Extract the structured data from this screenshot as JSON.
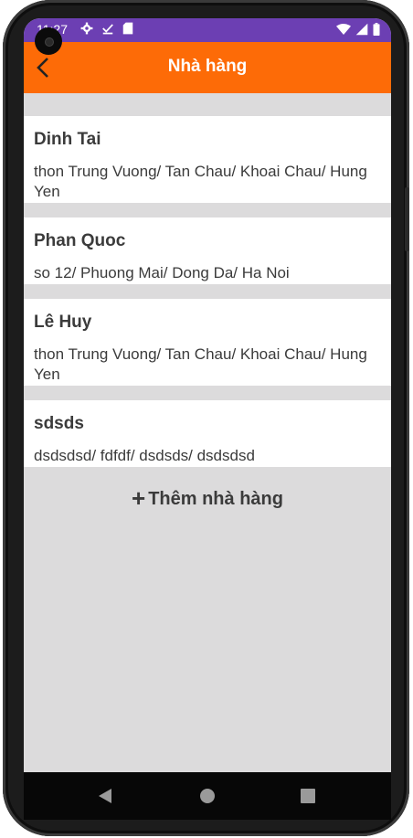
{
  "status_bar": {
    "time": "11:27",
    "left_icons": [
      "settings-icon",
      "check-download-icon",
      "sd-card-icon"
    ],
    "right_icons": [
      "wifi-icon",
      "signal-icon",
      "battery-icon"
    ]
  },
  "app_bar": {
    "title": "Nhà hàng",
    "back_icon": "arrow-back-icon",
    "background": "#fd6b07"
  },
  "restaurants": [
    {
      "name": "Dinh Tai",
      "address": "thon Trung Vuong/ Tan Chau/ Khoai Chau/ Hung Yen"
    },
    {
      "name": "Phan Quoc",
      "address": "so 12/ Phuong Mai/ Dong Da/ Ha Noi"
    },
    {
      "name": "Lê Huy",
      "address": "thon Trung Vuong/ Tan Chau/ Khoai Chau/ Hung Yen"
    },
    {
      "name": "sdsds",
      "address": "dsdsdsd/ fdfdf/ dsdsds/ dsdsdsd"
    }
  ],
  "add_button": {
    "icon": "plus-icon",
    "label": "Thêm nhà hàng"
  },
  "colors": {
    "status_bar": "#6c3fb3",
    "accent": "#fd6b07",
    "background": "#dcdbdc"
  }
}
